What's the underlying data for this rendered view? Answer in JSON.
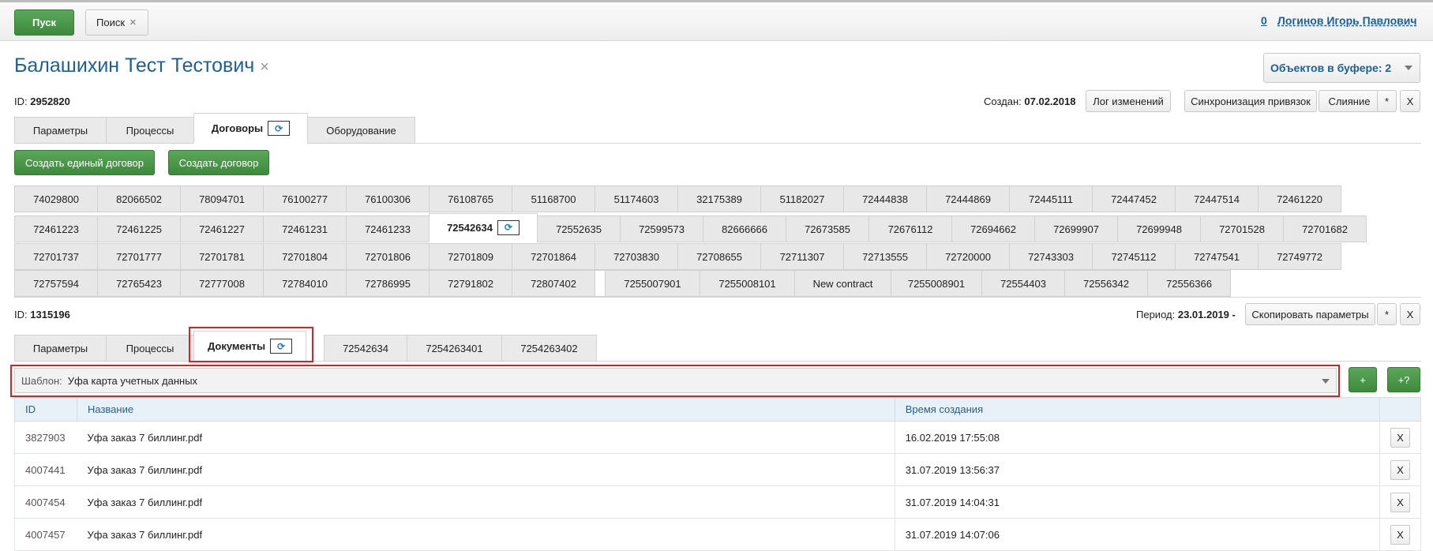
{
  "topbar": {
    "start_label": "Пуск",
    "search_tab_label": "Поиск",
    "search_tab_close": "×",
    "counter": "0",
    "user_name": "Логинов Игорь Павлович"
  },
  "header": {
    "title": "Балашихин Тест Тестович",
    "title_close": "×",
    "buffer_label": "Объектов в буфере: 2",
    "id_label": "ID:",
    "id_value": "2952820",
    "created_label": "Создан:",
    "created_value": "07.02.2018",
    "log_button": "Лог изменений",
    "sync_button": "Синхронизация привязок",
    "merge_button": "Слияние",
    "star_button": "*",
    "close_button": "X"
  },
  "main_tabs": [
    {
      "label": "Параметры"
    },
    {
      "label": "Процессы"
    },
    {
      "label": "Договоры",
      "sync": "⟳"
    },
    {
      "label": "Оборудование"
    }
  ],
  "contract_actions": {
    "create_single": "Создать единый договор",
    "create": "Создать договор"
  },
  "contracts": {
    "row1": [
      "74029800",
      "82066502",
      "78094701",
      "76100277",
      "76100306",
      "76108765",
      "51168700",
      "51174603",
      "32175389",
      "51182027",
      "72444838",
      "72444869",
      "72445111",
      "72447452",
      "72447514",
      "72461220"
    ],
    "row2": [
      "72461223",
      "72461225",
      "72461227",
      "72461231",
      "72461233",
      "72542634",
      "72552635",
      "72599573",
      "82666666",
      "72673585",
      "72676112",
      "72694662",
      "72699907",
      "72699948",
      "72701528",
      "72701682"
    ],
    "row3": [
      "72701737",
      "72701777",
      "72701781",
      "72701804",
      "72701806",
      "72701809",
      "72701864",
      "72703830",
      "72708655",
      "72711307",
      "72713555",
      "72720000",
      "72743303",
      "72745112",
      "72747541",
      "72749772"
    ],
    "row4": [
      "72757594",
      "72765423",
      "72777008",
      "72784010",
      "72786995",
      "72791802",
      "72807402",
      "",
      "7255007901",
      "7255008101",
      "New contract",
      "7255008901",
      "72554403",
      "72556342",
      "72556366"
    ],
    "active_sync": "⟳"
  },
  "contract_info": {
    "id_label": "ID:",
    "id_value": "1315196",
    "period_label": "Период:",
    "period_value": "23.01.2019 -",
    "copy_button": "Скопировать параметры",
    "star_button": "*",
    "close_button": "X"
  },
  "sub_tabs": [
    {
      "label": "Параметры"
    },
    {
      "label": "Процессы"
    },
    {
      "label": "Документы",
      "sync": "⟳"
    },
    {
      "label": "72542634"
    },
    {
      "label": "7254263401"
    },
    {
      "label": "7254263402"
    }
  ],
  "template": {
    "label": "Шаблон:",
    "value": "Уфа карта учетных данных",
    "add_button": "+",
    "add_q_button": "+?"
  },
  "documents": {
    "headers": [
      "ID",
      "Название",
      "Время создания",
      ""
    ],
    "rows": [
      {
        "id": "3827903",
        "name": "Уфа заказ 7 биллинг.pdf",
        "time": "16.02.2019 17:55:08",
        "del": "X"
      },
      {
        "id": "4007441",
        "name": "Уфа заказ 7 биллинг.pdf",
        "time": "31.07.2019 13:56:37",
        "del": "X"
      },
      {
        "id": "4007454",
        "name": "Уфа заказ 7 биллинг.pdf",
        "time": "31.07.2019 14:04:31",
        "del": "X"
      },
      {
        "id": "4007457",
        "name": "Уфа заказ 7 биллинг.pdf",
        "time": "31.07.2019 14:07:06",
        "del": "X"
      }
    ]
  },
  "colors": {
    "accent_blue": "#1d5f9a",
    "green": "#3d8a3d",
    "highlight_red": "#e02020"
  }
}
